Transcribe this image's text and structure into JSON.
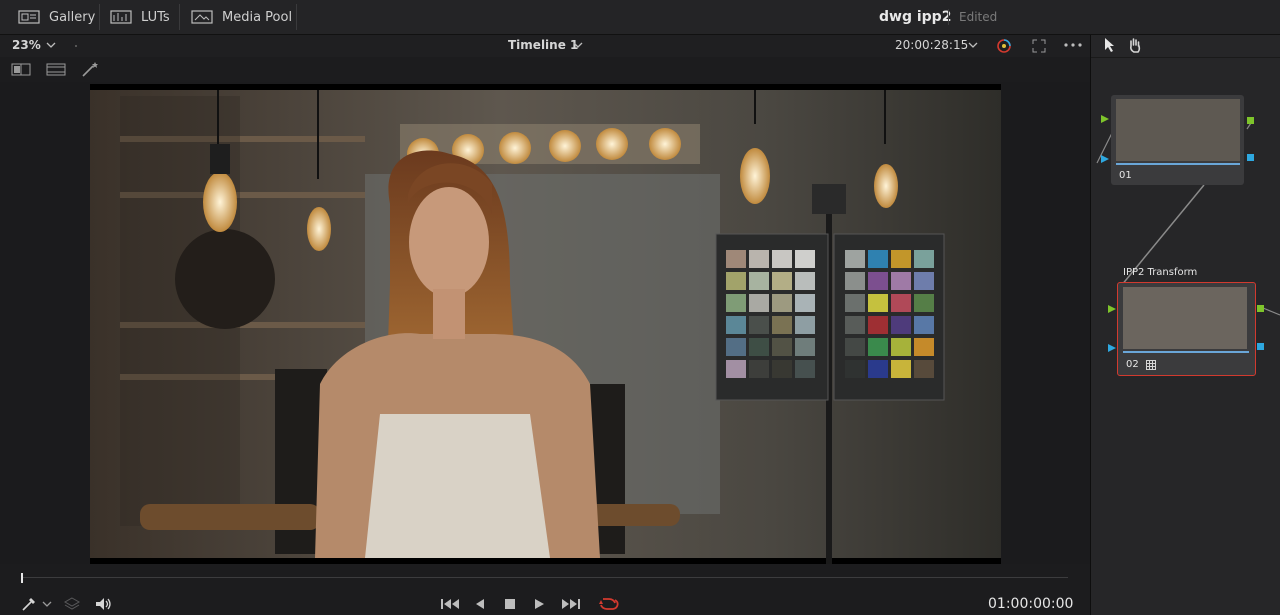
{
  "topbar": {
    "gallery_label": "Gallery",
    "luts_label": "LUTs",
    "media_pool_label": "Media Pool",
    "project_name": "dwg ipp2",
    "project_status": "Edited"
  },
  "viewer_bar": {
    "zoom": "23%",
    "timeline_name": "Timeline 1",
    "timecode": "20:00:28:15"
  },
  "transport": {
    "timecode": "01:00:00:00"
  },
  "nodes": [
    {
      "label": "01",
      "title": ""
    },
    {
      "label": "02",
      "title": "IPP2 Transform"
    }
  ],
  "colors": {
    "accent_red": "#d23a2f",
    "node_green": "#7ec42b",
    "node_blue": "#2ea8e0",
    "playhead": "#e6e6e6"
  },
  "icons": [
    "gallery-icon",
    "luts-icon",
    "media-pool-icon",
    "chevron-down-icon",
    "color-picker-icon",
    "fullscreen-icon",
    "more-icon",
    "pointer-icon",
    "hand-icon",
    "split-view-icon",
    "widescreen-icon",
    "magic-wand-icon",
    "eyedropper-icon",
    "layers-icon",
    "volume-icon",
    "skip-start-icon",
    "step-back-icon",
    "stop-icon",
    "play-icon",
    "skip-end-icon",
    "loop-icon",
    "grid-icon"
  ]
}
